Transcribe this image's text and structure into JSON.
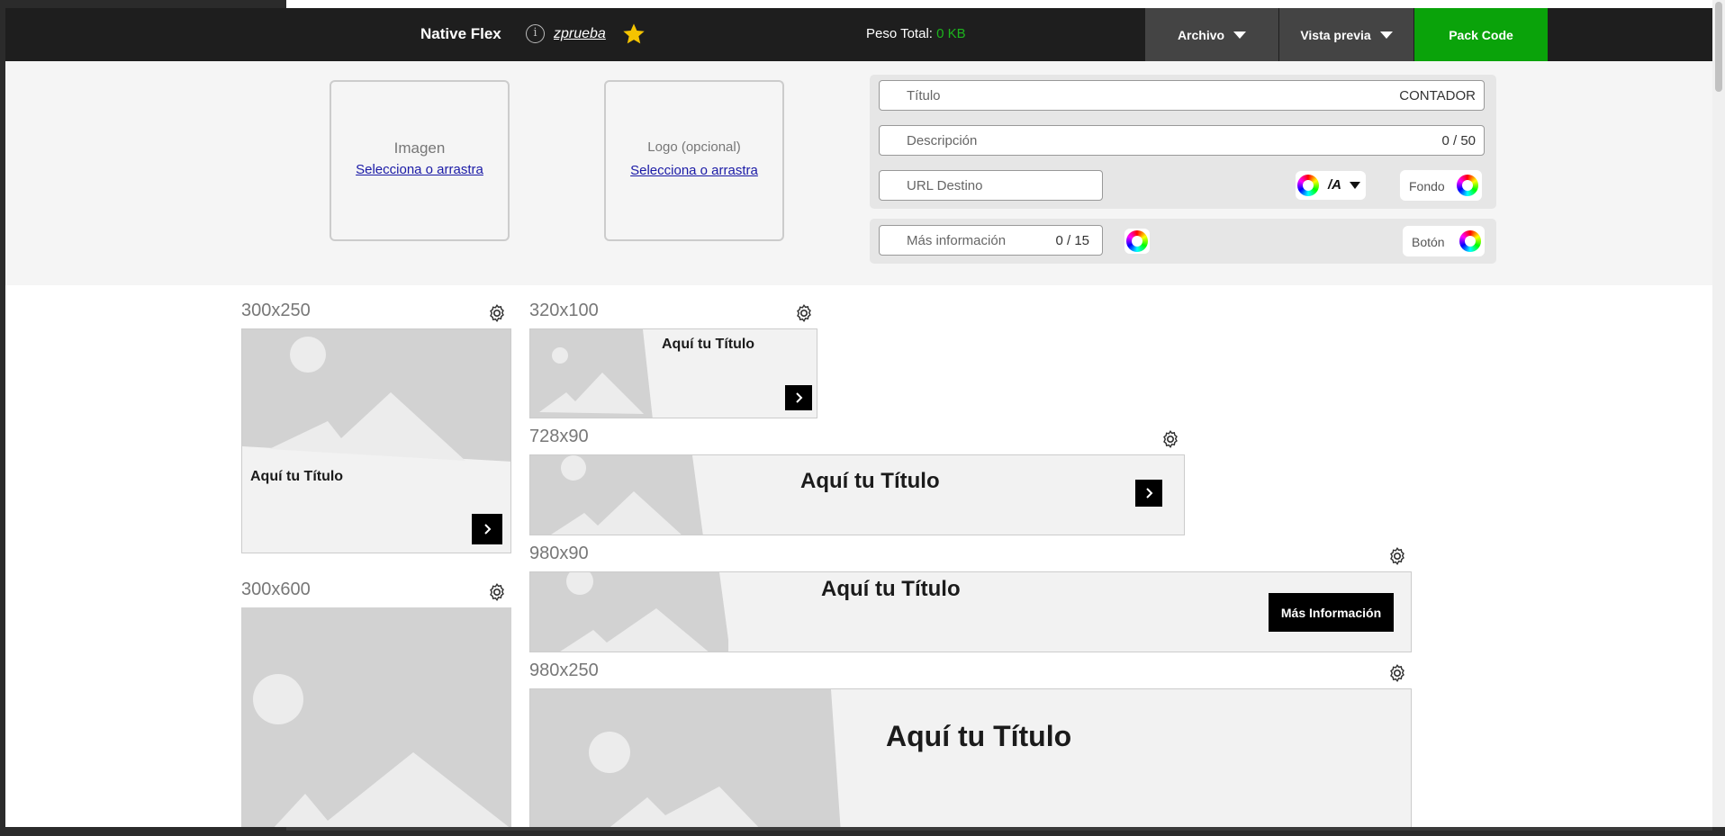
{
  "header": {
    "app_title": "Native Flex",
    "project_name": "zprueba",
    "peso_label": "Peso Total:",
    "peso_value": "0 KB",
    "archivo_label": "Archivo",
    "vista_previa_label": "Vista previa",
    "pack_code_label": "Pack Code"
  },
  "uploads": {
    "imagen_label": "Imagen",
    "imagen_link": "Selecciona o arrastra",
    "logo_label": "Logo (opcional)",
    "logo_link": "Selecciona o arrastra"
  },
  "form": {
    "titulo_placeholder": "Título",
    "titulo_value": "CONTADOR",
    "descripcion_placeholder": "Descripción",
    "descripcion_counter": "0 / 50",
    "url_placeholder": "URL Destino",
    "font_toggle_label": "/A",
    "fondo_label": "Fondo",
    "mas_info_placeholder": "Más información",
    "mas_info_counter": "0 / 15",
    "boton_label": "Botón"
  },
  "banners": [
    {
      "size": "300x250",
      "title": "Aquí tu Título"
    },
    {
      "size": "320x100",
      "title": "Aquí tu Título"
    },
    {
      "size": "728x90",
      "title": "Aquí tu Título"
    },
    {
      "size": "980x90",
      "title": "Aquí tu Título",
      "button": "Más Información"
    },
    {
      "size": "300x600",
      "title": ""
    },
    {
      "size": "980x250",
      "title": "Aquí tu Título"
    }
  ],
  "colors": {
    "header_bg": "#1e1e1e",
    "pack_code_bg": "#0aa30a",
    "peso_value": "#1db41d",
    "star": "#f5c400",
    "link": "#1a1aa6"
  }
}
